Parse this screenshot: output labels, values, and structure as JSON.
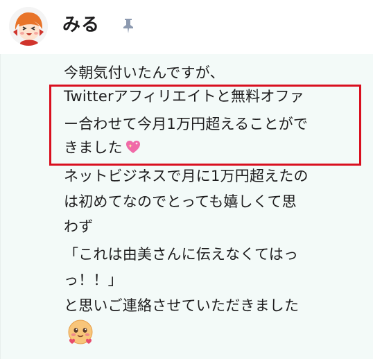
{
  "header": {
    "sender_name": "みる",
    "pin_icon": "pin-icon",
    "avatar_icon": "user-avatar-icon"
  },
  "message": {
    "lines": [
      "今朝気付いたんですが、",
      "Twitterアフィリエイトと無料オファ",
      "ー合わせて今月1万円超えることがで",
      "きました",
      "ネットビジネスで月に1万円超えたの",
      "は初めてなのでとっても嬉しくて思",
      "わず",
      "「これは由美さんに伝えなくてはっ",
      "っ！！」",
      "と思いご連絡させていただきました"
    ],
    "emoji_heart": "sparkling-heart-icon",
    "emoji_face": "blushing-face-icon"
  },
  "colors": {
    "highlight_border": "#d90f1f",
    "message_background": "#f3faf8",
    "text": "#1d1c1d"
  }
}
